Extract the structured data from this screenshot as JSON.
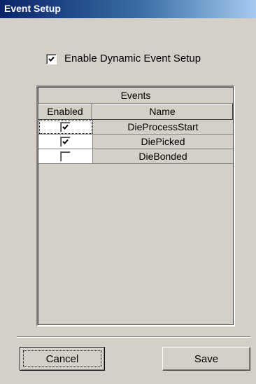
{
  "window": {
    "title": "Event Setup"
  },
  "enable_dynamic": {
    "label": "Enable Dynamic Event Setup",
    "checked": true
  },
  "grid": {
    "band_title": "Events",
    "columns": [
      "Enabled",
      "Name"
    ],
    "rows": [
      {
        "enabled": true,
        "name": "DieProcessStart"
      },
      {
        "enabled": true,
        "name": "DiePicked"
      },
      {
        "enabled": false,
        "name": "DieBonded"
      }
    ]
  },
  "buttons": {
    "cancel": "Cancel",
    "save": "Save"
  },
  "colors": {
    "face": "#d4d0c8",
    "title_start": "#0a246a",
    "title_end": "#a6caf0"
  }
}
